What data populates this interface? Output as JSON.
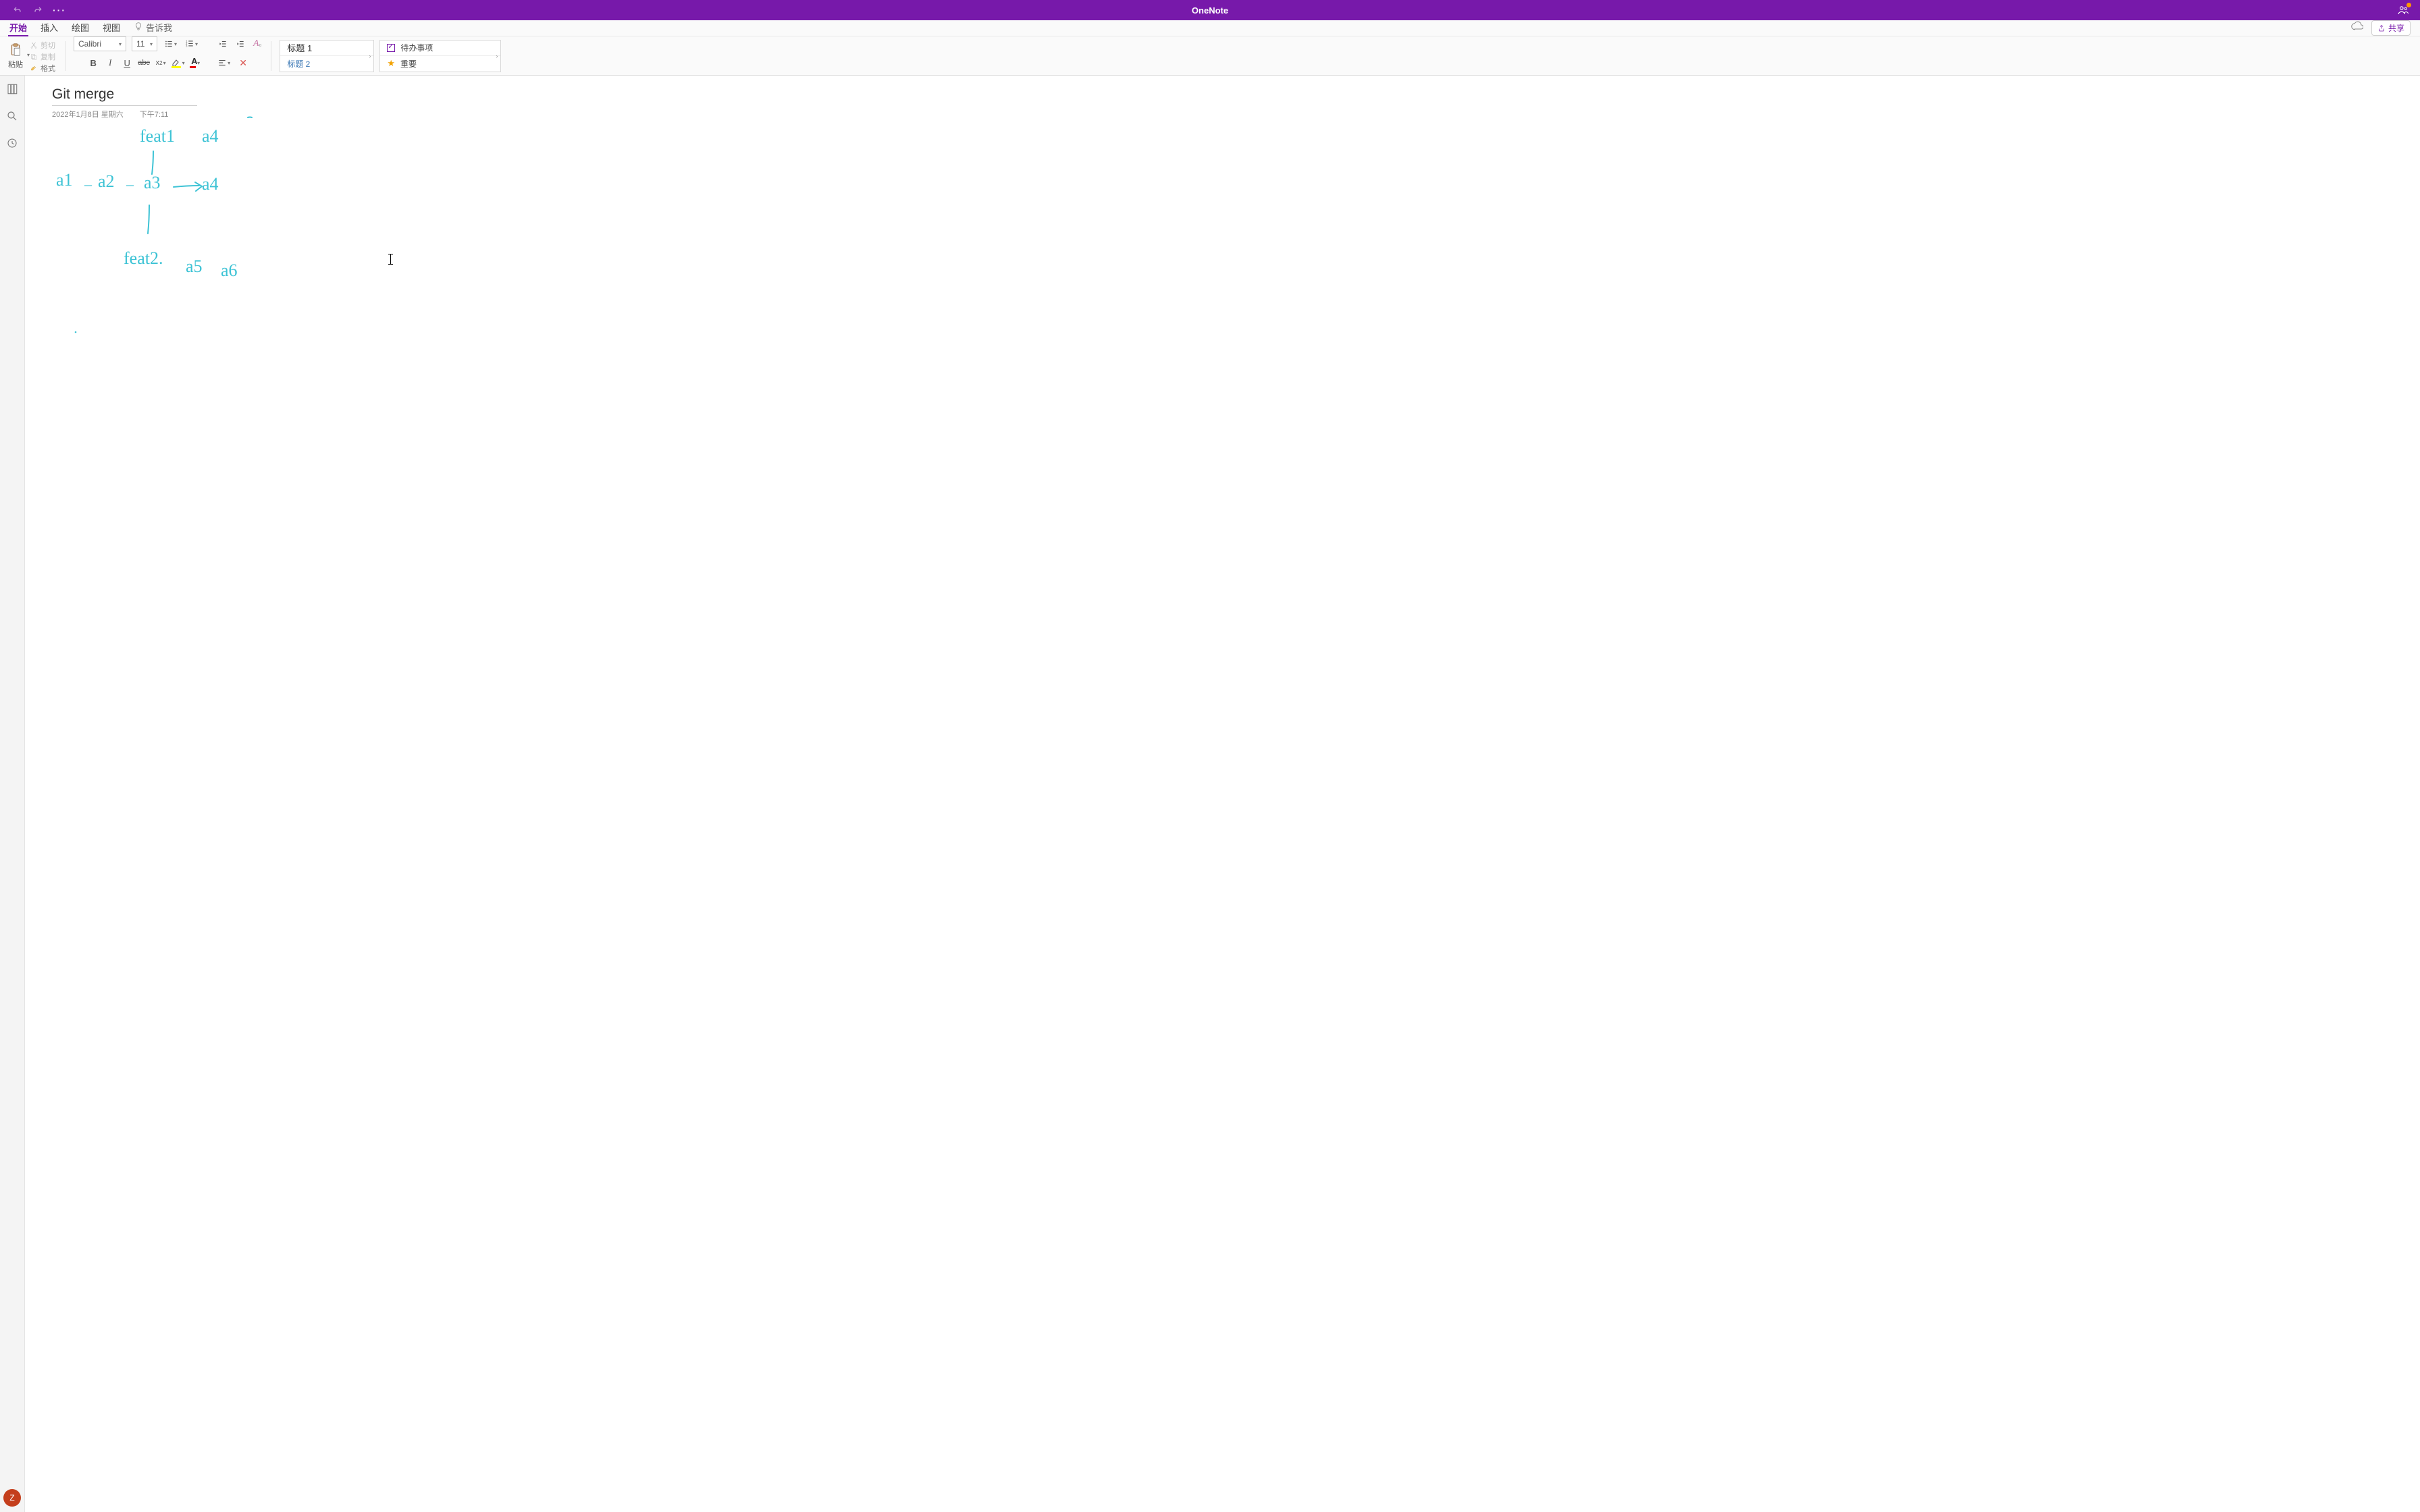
{
  "titlebar": {
    "app_name": "OneNote"
  },
  "menubar": {
    "tabs": [
      "开始",
      "插入",
      "绘图",
      "视图"
    ],
    "tell_me": "告诉我",
    "share": "共享"
  },
  "ribbon": {
    "paste": "粘贴",
    "cut": "剪切",
    "copy": "复制",
    "format_painter": "格式",
    "font_name": "Calibri",
    "font_size": "11",
    "styles": {
      "h1": "标题 1",
      "h2": "标题 2"
    },
    "tags": {
      "todo": "待办事项",
      "important": "重要"
    }
  },
  "page": {
    "title": "Git merge",
    "date": "2022年1月8日 星期六",
    "time": "下午7:11"
  },
  "ink": {
    "t_feat1": "feat1",
    "t_a4top": "a4",
    "t_a1": "a1",
    "t_a2": "a2",
    "t_a3": "a3",
    "t_a4": "a4",
    "t_feat2": "feat2.",
    "t_a5": "a5",
    "t_a6": "a6"
  },
  "avatar_initial": "Z"
}
